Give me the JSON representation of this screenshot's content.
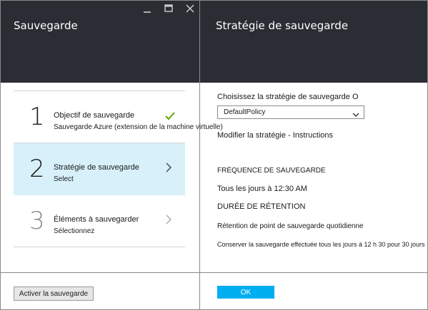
{
  "left_blade": {
    "title": "Sauvegarde",
    "steps": [
      {
        "number": "1",
        "title": "Objectif de sauvegarde",
        "subtitle": "Sauvegarde Azure (extension de la machine virtuelle)",
        "status": "completed"
      },
      {
        "number": "2",
        "title": "Stratégie de sauvegarde",
        "subtitle": "Select",
        "status": "active"
      },
      {
        "number": "3",
        "title": "Éléments à sauvegarder",
        "subtitle": "Sélectionnez",
        "status": "disabled"
      }
    ],
    "enable_button": "Activer la sauvegarde"
  },
  "right_blade": {
    "title": "Stratégie de sauvegarde",
    "choose_label": "Choisissez la stratégie de sauvegarde O",
    "policy_selected": "DefaultPolicy",
    "modify_link": "Modifier la stratégie - Instructions",
    "frequency_heading": "FRÉQUENCE DE SAUVEGARDE",
    "frequency_value": "Tous les jours à 12:30 AM",
    "retention_heading": "DURÉE DE RÉTENTION",
    "retention_label": "Rétention de point de sauvegarde quotidienne",
    "retention_detail": "Conserver la sauvegarde effectuée tous les jours à 12 h 30 pour 30 jours",
    "ok_button": "OK"
  },
  "colors": {
    "header_bg": "#2a2d33",
    "active_step_bg": "#d8f0fa",
    "check_green": "#5ea800",
    "ok_blue": "#00aff0"
  },
  "icons": {
    "minimize": "minimize-icon",
    "maximize": "maximize-icon",
    "close": "close-icon",
    "check": "checkmark-icon",
    "chevron": "chevron-right-icon",
    "dropdown": "chevron-down-icon"
  }
}
